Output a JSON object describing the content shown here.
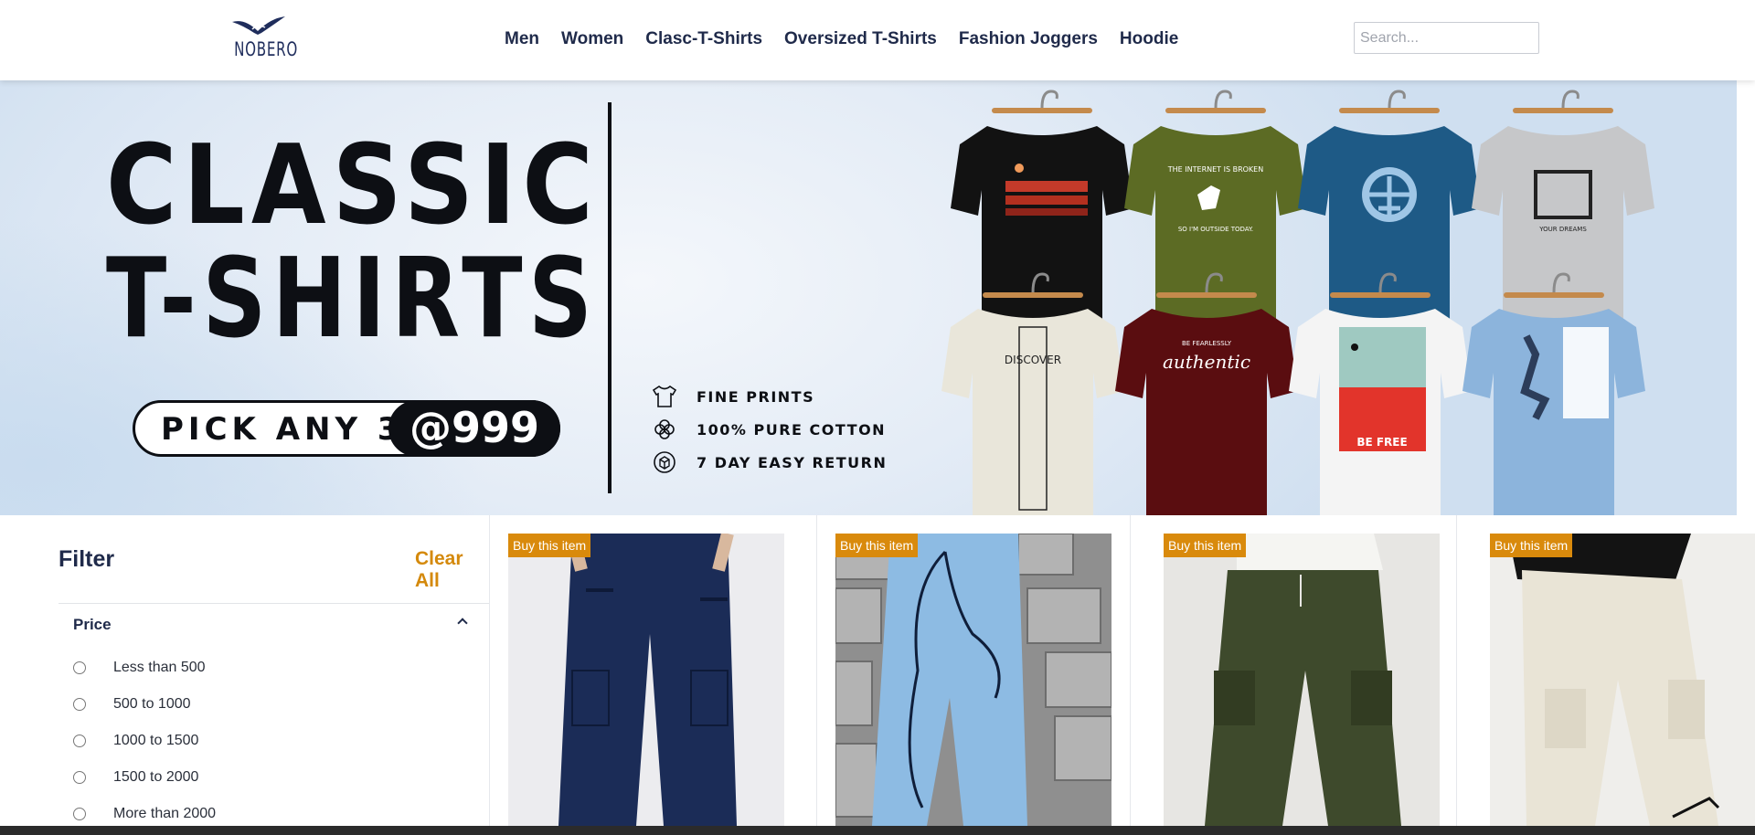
{
  "header": {
    "logo_text": "NOBERO",
    "nav": [
      "Men",
      "Women",
      "Clasc-T-Shirts",
      "Oversized T-Shirts",
      "Fashion Joggers",
      "Hoodie"
    ],
    "search_placeholder": "Search..."
  },
  "banner": {
    "title_line1": "CLASSIC",
    "title_line2": "T-SHIRTS",
    "pick_text": "PICK ANY 3",
    "pick_price": "@999",
    "features": [
      {
        "icon": "tshirt-icon",
        "text": "FINE PRINTS"
      },
      {
        "icon": "cotton-icon",
        "text": "100% PURE COTTON"
      },
      {
        "icon": "return-box-icon",
        "text": "7 DAY EASY RETURN"
      }
    ],
    "shirt_prints": [
      "THE INTERNET IS BROKEN",
      "SO I'M OUTSIDE TODAY.",
      "YOUR DREAMS",
      "BE FEARLESSLY",
      "authentic",
      "BE FREE",
      "DISCOVER"
    ]
  },
  "filter": {
    "title": "Filter",
    "clear_all": "Clear All",
    "price_heading": "Price",
    "price_options": [
      "Less than 500",
      "500 to 1000",
      "1000 to 1500",
      "1500 to 2000",
      "More than 2000"
    ]
  },
  "products": [
    {
      "badge": "Buy this item",
      "color": "#1b2c57"
    },
    {
      "badge": "Buy this item",
      "color": "#8dbbe3"
    },
    {
      "badge": "Buy this item",
      "color": "#3e4a2c"
    },
    {
      "badge": "Buy this item",
      "color": "#e9e4d6"
    }
  ]
}
